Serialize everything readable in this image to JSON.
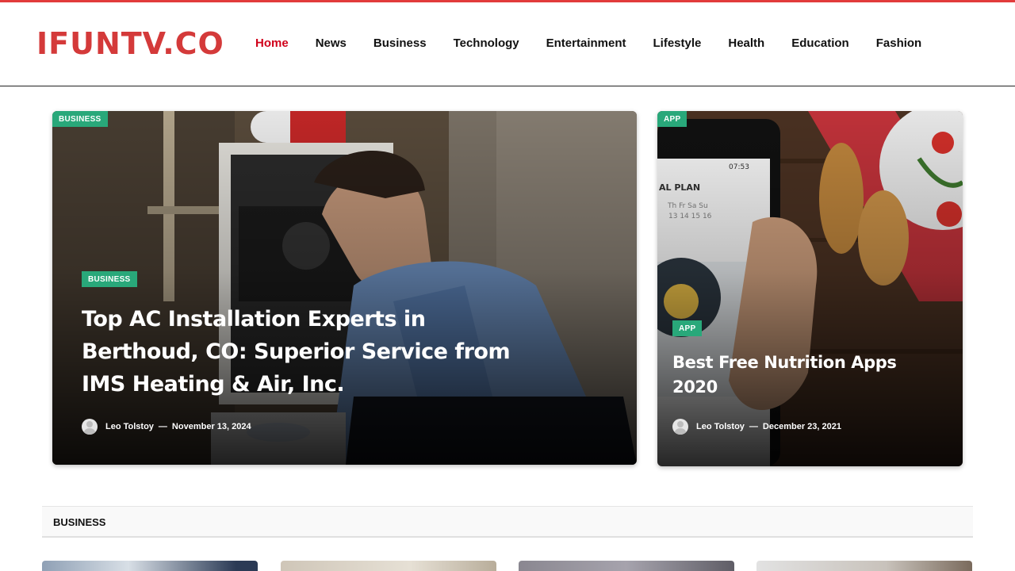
{
  "site": {
    "logo": "IFUNTV.CO",
    "accent_color": "#d43a3a",
    "badge_color": "#29a87a"
  },
  "nav": {
    "items": [
      {
        "label": "Home",
        "active": true
      },
      {
        "label": "News"
      },
      {
        "label": "Business"
      },
      {
        "label": "Technology"
      },
      {
        "label": "Entertainment"
      },
      {
        "label": "Lifestyle"
      },
      {
        "label": "Health"
      },
      {
        "label": "Education"
      },
      {
        "label": "Fashion"
      }
    ]
  },
  "featured": {
    "main": {
      "corner_badge": "BUSINESS",
      "category": "BUSINESS",
      "title": "Top AC Installation Experts in Berthoud, CO: Superior Service from IMS Heating & Air, Inc.",
      "author": "Leo Tolstoy",
      "separator": "—",
      "date": "November 13, 2024",
      "image": "technician-furnace-photo"
    },
    "side": {
      "corner_badge": "APP",
      "category": "APP",
      "title": "Best Free Nutrition Apps 2020",
      "author": "Leo Tolstoy",
      "separator": "—",
      "date": "December 23, 2021",
      "image": "phone-meal-plan-photo"
    }
  },
  "section": {
    "title": "BUSINESS"
  }
}
